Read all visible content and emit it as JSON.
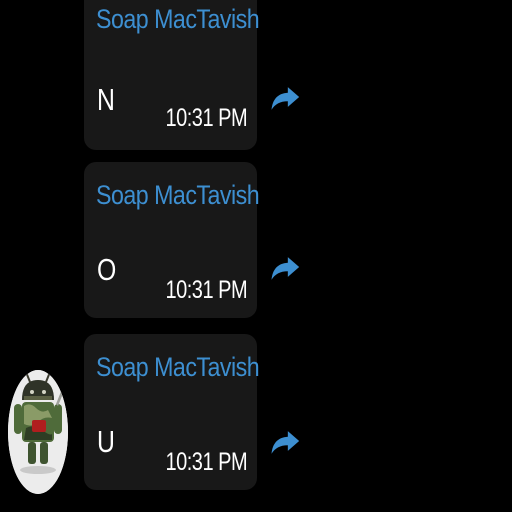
{
  "colors": {
    "background": "#000000",
    "bubble": "#181818",
    "sender_name": "#3d8fd1",
    "text": "#ffffff",
    "share_icon": "#3d8fd1"
  },
  "messages": [
    {
      "sender": "Soap MacTavish",
      "text": "N",
      "time": "10:31 PM",
      "icon": "share-arrow-icon"
    },
    {
      "sender": "Soap MacTavish",
      "text": "O",
      "time": "10:31 PM",
      "icon": "share-arrow-icon"
    },
    {
      "sender": "Soap MacTavish",
      "text": "U",
      "time": "10:31 PM",
      "icon": "share-arrow-icon"
    }
  ],
  "avatar": {
    "icon": "android-figure-avatar-icon"
  }
}
